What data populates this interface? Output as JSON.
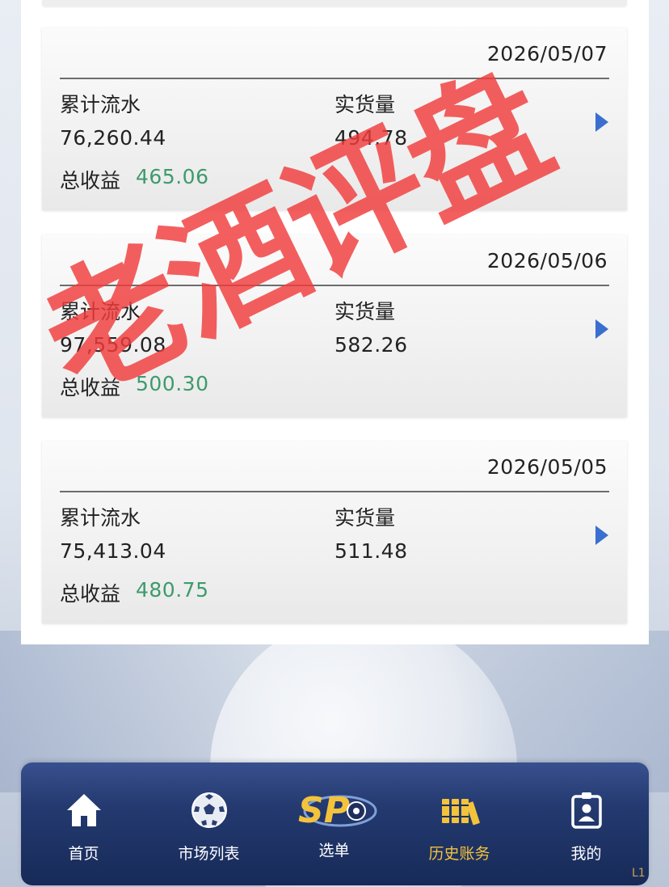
{
  "records": [
    {
      "date": "2026/05/07",
      "turnover_label": "累计流水",
      "turnover": "76,260.44",
      "actual_label": "实货量",
      "actual": "494.78",
      "profit_label": "总收益",
      "profit": "465.06"
    },
    {
      "date": "2026/05/06",
      "turnover_label": "累计流水",
      "turnover": "97,559.08",
      "actual_label": "实货量",
      "actual": "582.26",
      "profit_label": "总收益",
      "profit": "500.30"
    },
    {
      "date": "2026/05/05",
      "turnover_label": "累计流水",
      "turnover": "75,413.04",
      "actual_label": "实货量",
      "actual": "511.48",
      "profit_label": "总收益",
      "profit": "480.75"
    }
  ],
  "watermark": "老酒评盘",
  "nav": {
    "items": [
      {
        "label": "首页",
        "icon": "home-icon"
      },
      {
        "label": "市场列表",
        "icon": "soccer-ball-icon"
      },
      {
        "label": "选单",
        "icon": "sp-logo-icon"
      },
      {
        "label": "历史账务",
        "icon": "ledger-icon",
        "active": true
      },
      {
        "label": "我的",
        "icon": "profile-badge-icon"
      }
    ],
    "logo_text": "SP"
  },
  "corner_mark": "L1",
  "colors": {
    "profit": "#3d9b6c",
    "arrow": "#3a6fcf",
    "nav_active": "#f3c33c",
    "watermark": "#f03c3c"
  }
}
